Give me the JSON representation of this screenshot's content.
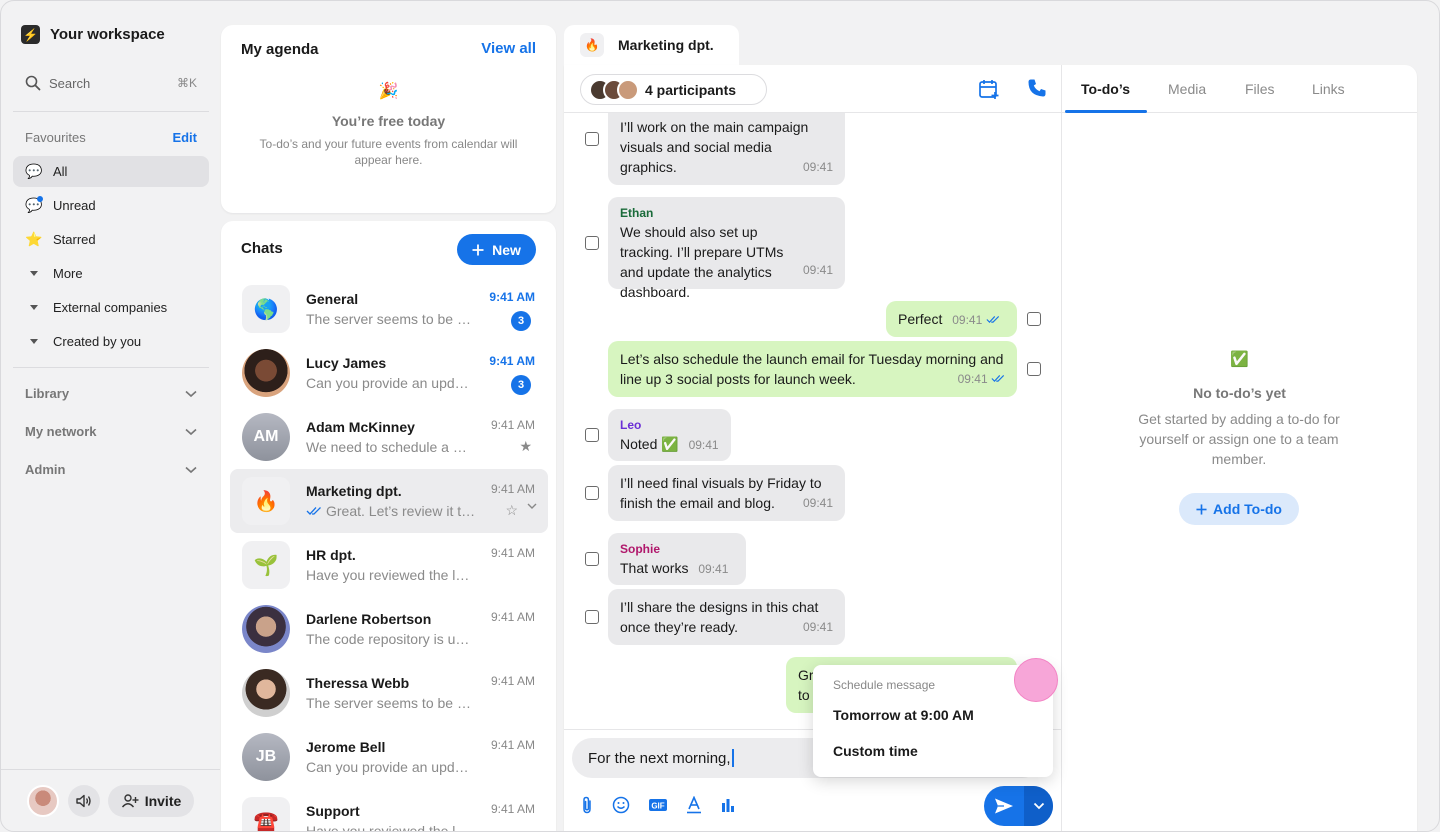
{
  "workspace": {
    "logo": "⚡",
    "name": "Your workspace"
  },
  "search": {
    "label": "Search",
    "shortcut": "⌘K"
  },
  "favourites": {
    "header": "Favourites",
    "edit": "Edit"
  },
  "nav": [
    {
      "label": "All",
      "icon": "chat-bubble-icon"
    },
    {
      "label": "Unread",
      "icon": "unread-chat-icon"
    },
    {
      "label": "Starred",
      "icon": "star-icon"
    },
    {
      "label": "More",
      "icon": "caret-icon"
    },
    {
      "label": "External companies",
      "icon": "caret-icon"
    },
    {
      "label": "Created by you",
      "icon": "caret-icon"
    }
  ],
  "sections": [
    {
      "label": "Library"
    },
    {
      "label": "My network"
    },
    {
      "label": "Admin"
    }
  ],
  "bottom": {
    "invite": "Invite"
  },
  "agenda": {
    "title": "My agenda",
    "view_all": "View all",
    "emoji": "🎉",
    "empty_title": "You’re free today",
    "empty_desc": "To-do’s and your future events from calendar will appear here."
  },
  "chats": {
    "title": "Chats",
    "new_label": "New",
    "items": [
      {
        "avatar": "🌎",
        "name": "General",
        "preview": "The server seems to be down again.",
        "time": "9:41 AM",
        "badge": "3"
      },
      {
        "avatar": "",
        "name": "Lucy James",
        "preview": "Can you provide an update?",
        "time": "9:41 AM",
        "badge": "3"
      },
      {
        "avatar": "AM",
        "name": "Adam McKinney",
        "preview": "We need to schedule a meeting.",
        "time": "9:41 AM"
      },
      {
        "avatar": "🔥",
        "name": "Marketing dpt.",
        "preview": "Great. Let’s review it tomorrow.",
        "time": "9:41 AM"
      },
      {
        "avatar": "🌱",
        "name": "HR dpt.",
        "preview": "Have you reviewed the latest draft?",
        "time": "9:41 AM"
      },
      {
        "avatar": "",
        "name": "Darlene Robertson",
        "preview": "The code repository is updated.",
        "time": "9:41 AM"
      },
      {
        "avatar": "",
        "name": "Theressa Webb",
        "preview": "The server seems to be down again.",
        "time": "9:41 AM"
      },
      {
        "avatar": "JB",
        "name": "Jerome Bell",
        "preview": "Can you provide an update?",
        "time": "9:41 AM"
      },
      {
        "avatar": "☎️",
        "name": "Support",
        "preview": "Have you reviewed the latest draft?",
        "time": "9:41 AM"
      }
    ]
  },
  "conversation": {
    "tab_icon": "🔥",
    "tab_title": "Marketing dpt.",
    "participants": "4 participants",
    "messages": [
      {
        "author": "",
        "text": "I’ll work on the main campaign visuals and social media graphics.",
        "time": "09:41"
      },
      {
        "author": "Ethan",
        "text": "We should also set up tracking. I’ll prepare UTMs and update the analytics dashboard.",
        "time": "09:41"
      },
      {
        "author": "",
        "text": "Perfect",
        "time": "09:41"
      },
      {
        "author": "",
        "text": "Let’s also schedule the launch email for Tuesday morning and line up 3 social posts for launch week.",
        "time": "09:41"
      },
      {
        "author": "Leo",
        "text": "Noted ✅",
        "time": "09:41"
      },
      {
        "author": "",
        "text": "I’ll need final visuals by Friday to finish the email and blog.",
        "time": "09:41"
      },
      {
        "author": "Sophie",
        "text": "That works",
        "time": "09:41"
      },
      {
        "author": "",
        "text": "I’ll share the designs in this chat once they’re ready.",
        "time": "09:41"
      },
      {
        "author": "",
        "text": "Gr",
        "text2": "to",
        "time": ""
      }
    ],
    "input_value": "For the next morning,"
  },
  "schedule_popup": {
    "header": "Schedule message",
    "option1": "Tomorrow at 9:00 AM",
    "option2": "Custom time"
  },
  "right_panel": {
    "tabs": [
      "To-do’s",
      "Media",
      "Files",
      "Links"
    ],
    "empty_icon": "✅",
    "empty_title": "No to-do’s yet",
    "empty_desc": "Get started by adding a to-do for yourself or assign one to a team member.",
    "add_label": "Add To-do"
  },
  "colors": {
    "accent": "#1673e8",
    "outgoing_bubble": "#d7f5c0",
    "incoming_bubble": "#e9e9eb"
  }
}
